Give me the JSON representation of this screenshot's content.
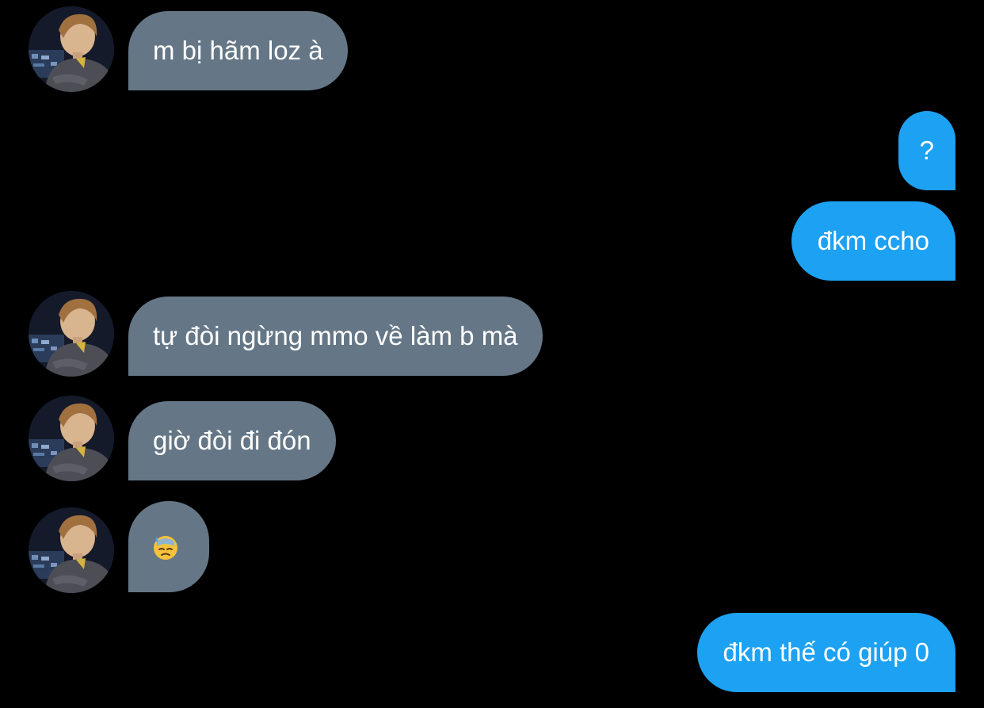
{
  "conversation": {
    "messages": [
      {
        "sender": "other",
        "text": "m bị hãm loz à"
      },
      {
        "sender": "me",
        "text": "?"
      },
      {
        "sender": "me",
        "text": "đkm ccho"
      },
      {
        "sender": "other",
        "text": "tự đòi ngừng mmo về làm b mà"
      },
      {
        "sender": "other",
        "text": "giờ đòi đi đón"
      },
      {
        "sender": "other",
        "emoji": "downcast-face-with-sweat"
      },
      {
        "sender": "me",
        "text": "đkm thế có giúp 0"
      }
    ]
  },
  "colors": {
    "background": "#000000",
    "incoming_bubble": "#657786",
    "outgoing_bubble": "#1da1f2",
    "text": "#ffffff"
  }
}
